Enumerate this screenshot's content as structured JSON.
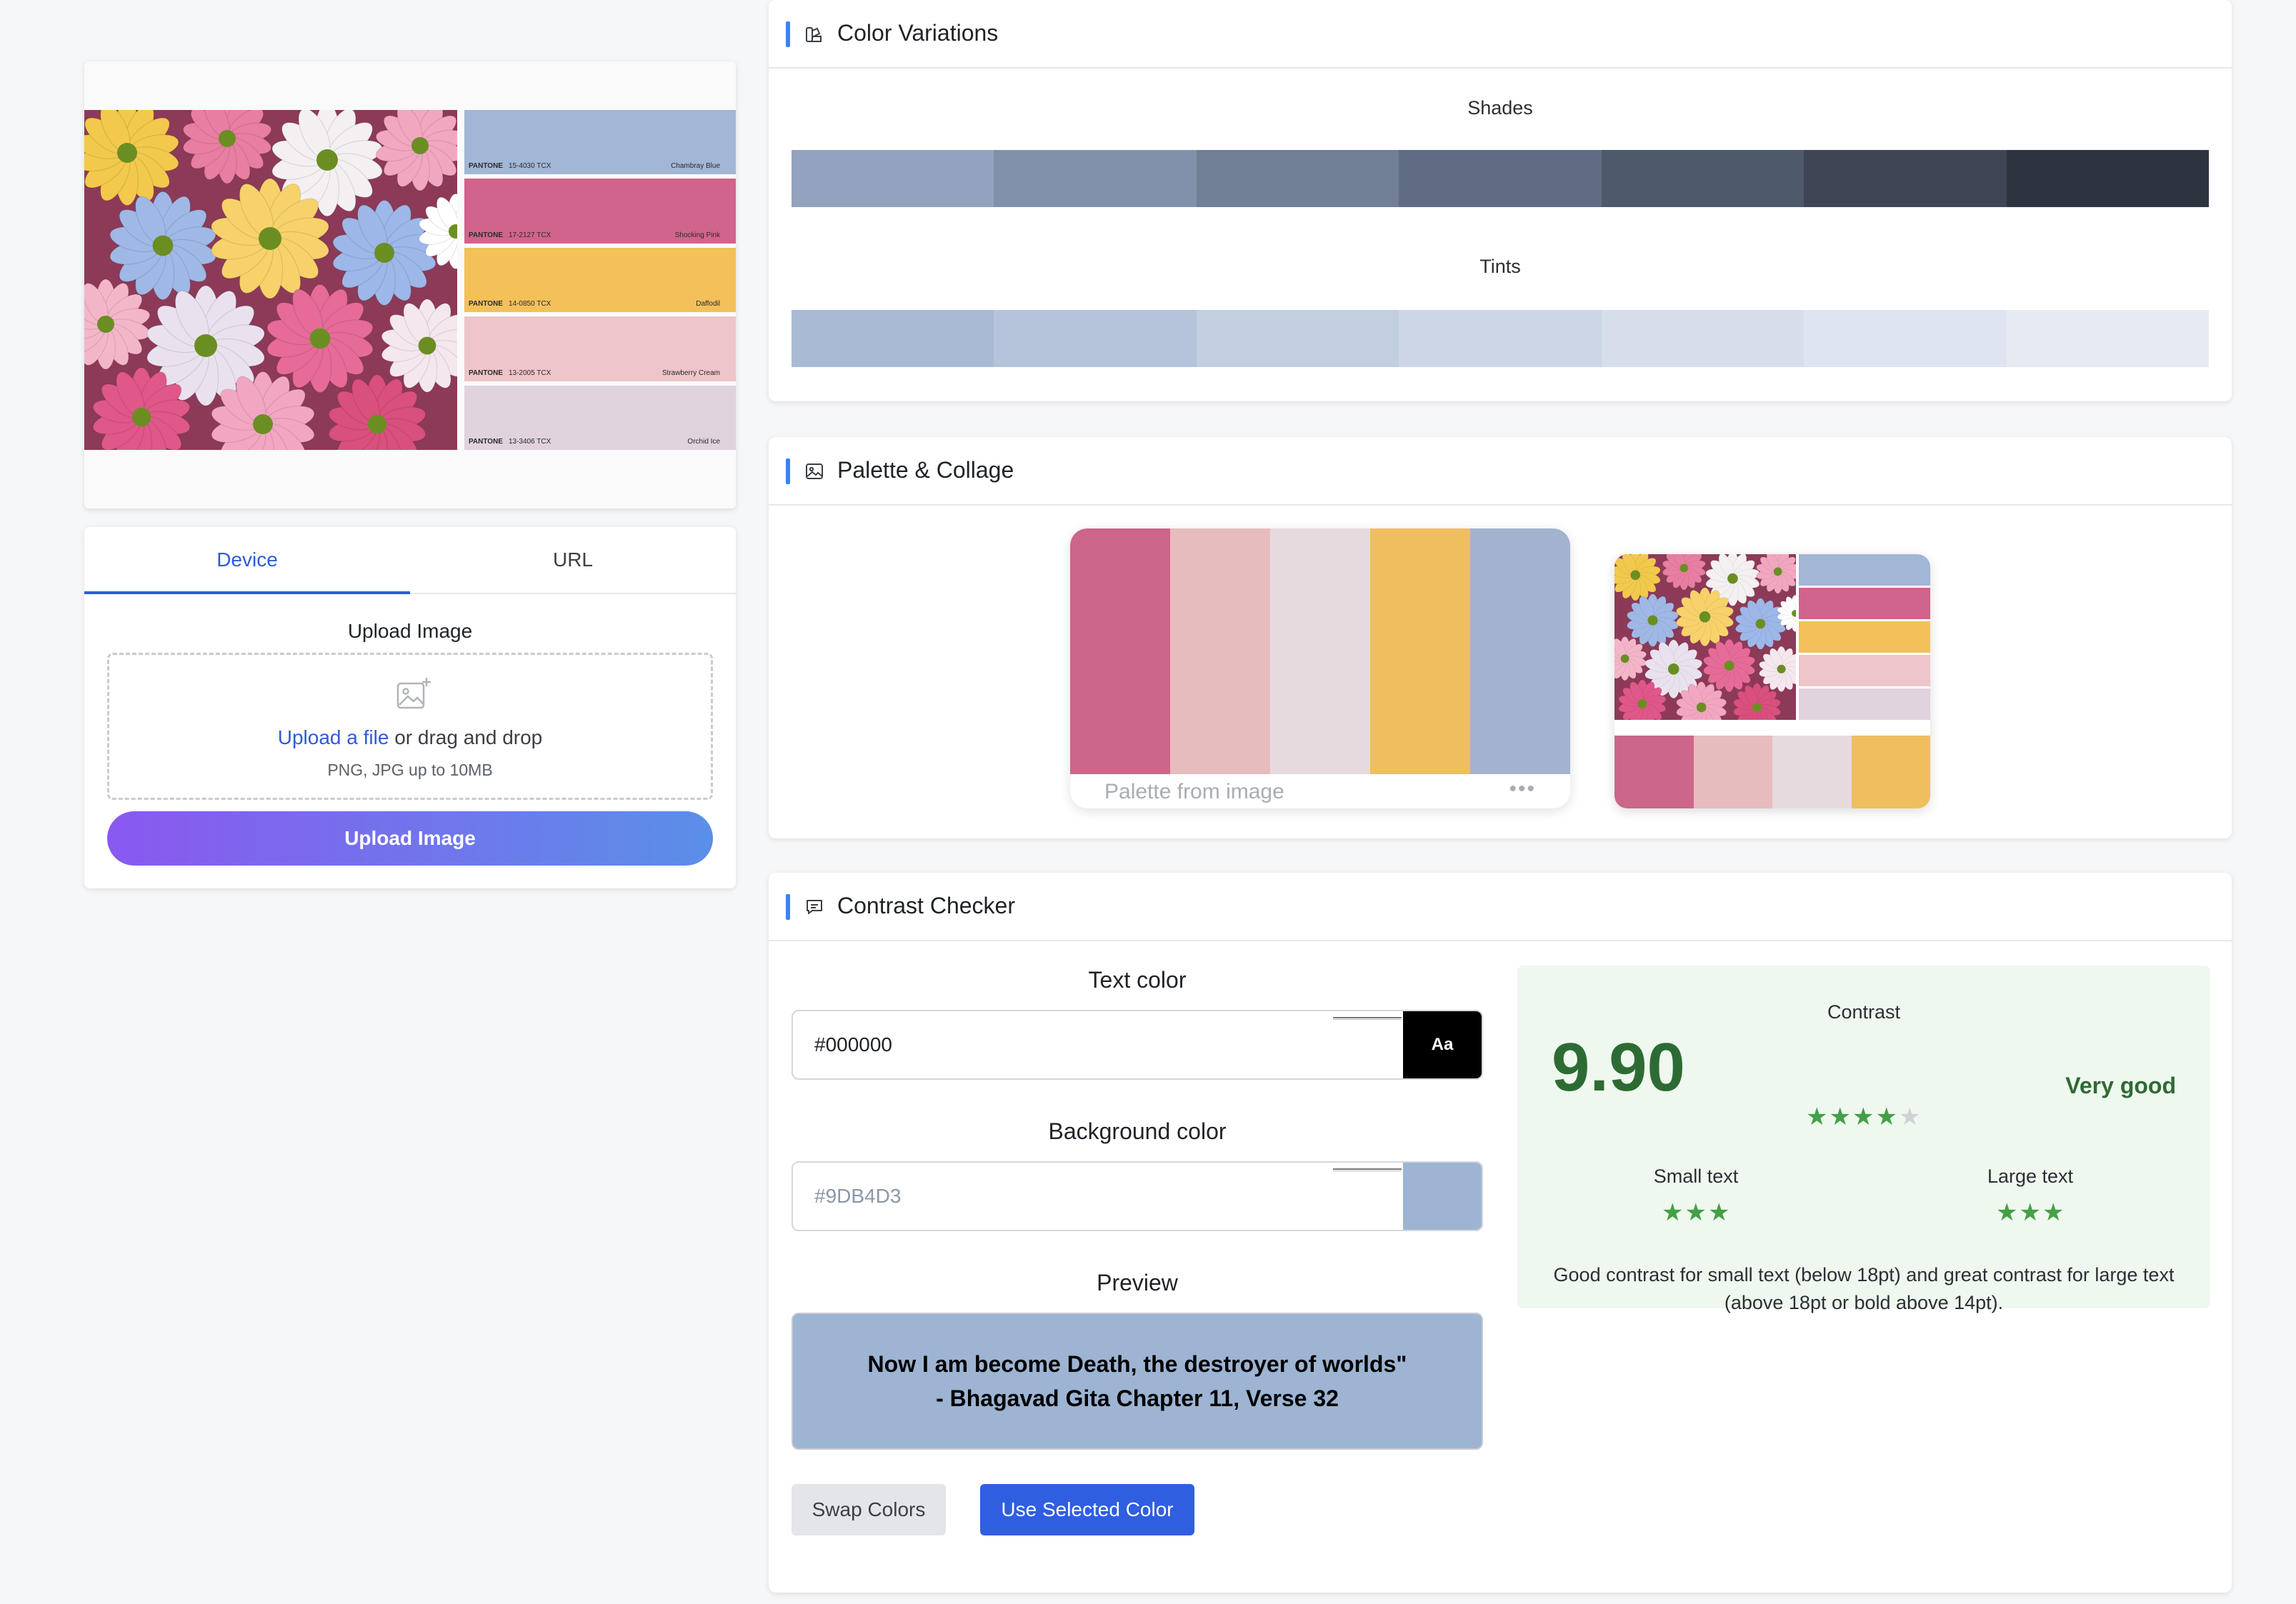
{
  "image_card": {
    "pantone_chips": [
      {
        "brand": "PANTONE",
        "code": "15-4030 TCX",
        "name": "Chambray Blue",
        "color": "#a2b6d6"
      },
      {
        "brand": "PANTONE",
        "code": "17-2127 TCX",
        "name": "Shocking Pink",
        "color": "#d1648c"
      },
      {
        "brand": "PANTONE",
        "code": "14-0850 TCX",
        "name": "Daffodil",
        "color": "#f3c05a"
      },
      {
        "brand": "PANTONE",
        "code": "13-2005 TCX",
        "name": "Strawberry Cream",
        "color": "#eec5c8"
      },
      {
        "brand": "PANTONE",
        "code": "13-3406 TCX",
        "name": "Orchid Ice",
        "color": "#e0d3dd"
      }
    ]
  },
  "upload": {
    "tabs": [
      {
        "label": "Device",
        "active": true
      },
      {
        "label": "URL",
        "active": false
      }
    ],
    "heading": "Upload Image",
    "link_text": "Upload a file",
    "drop_text": " or drag and drop",
    "hint": "PNG, JPG up to 10MB",
    "button_label": "Upload Image"
  },
  "variations": {
    "title": "Color Variations",
    "icon": "swatch-book-icon",
    "shades_label": "Shades",
    "tints_label": "Tints",
    "shades": [
      "#93a3bf",
      "#8291ab",
      "#717f97",
      "#606c83",
      "#4f596c",
      "#3e4656",
      "#2e343f"
    ],
    "tints": [
      "#a9bad5",
      "#b6c4db",
      "#c2cfe1",
      "#ccd6e6",
      "#d6deeb",
      "#dfe5f0",
      "#e6ebf3"
    ]
  },
  "palette": {
    "title": "Palette & Collage",
    "icon": "image-icon",
    "caption": "Palette from image",
    "more": "•••",
    "colors": [
      "#cc668a",
      "#e7bcbf",
      "#e7dadf",
      "#efbe5e",
      "#a3b3cf"
    ]
  },
  "contrast": {
    "title": "Contrast Checker",
    "icon": "message-square-icon",
    "text_color_label": "Text color",
    "text_color_value": "#000000",
    "text_swatch_label": "Aa",
    "background_label": "Background color",
    "background_placeholder": "#9DB4D3",
    "preview_label": "Preview",
    "preview_line1": "Now I am become Death, the destroyer of worlds\"",
    "preview_line2": "- Bhagavad Gita Chapter 11, Verse 32",
    "swap_label": "Swap Colors",
    "use_label": "Use Selected Color",
    "result": {
      "heading": "Contrast",
      "ratio": "9.90",
      "rating": "Very good",
      "overall_stars": 4,
      "overall_max": 5,
      "small_label": "Small text",
      "small_stars": 3,
      "large_label": "Large text",
      "large_stars": 3,
      "description": "Good contrast for small text (below 18pt) and great contrast for large text (above 18pt or bold above 14pt)."
    },
    "colors": {
      "text": "#000000",
      "background": "#9db4d3"
    }
  }
}
